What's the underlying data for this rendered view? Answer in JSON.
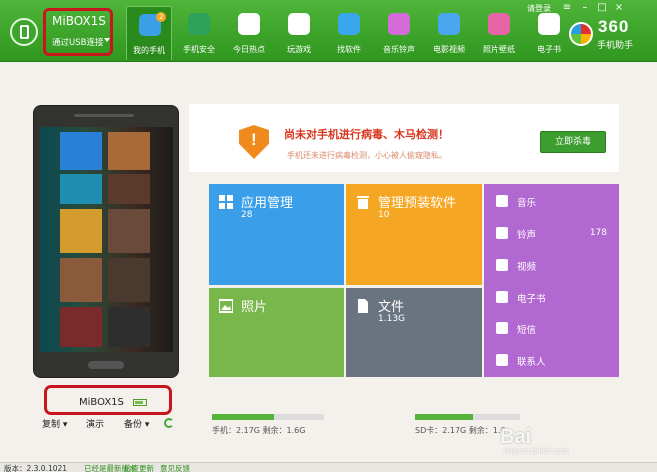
{
  "device": {
    "name": "MiBOX1S",
    "connection": "通过USB连接"
  },
  "nav": {
    "items": [
      {
        "label": "我的手机",
        "active": true,
        "badge": "2",
        "color": "#3aa0e6"
      },
      {
        "label": "手机安全",
        "color": "#2ea15b"
      },
      {
        "label": "今日热点",
        "color": "#ffffff"
      },
      {
        "label": "玩游戏",
        "color": "#ffffff"
      },
      {
        "label": "找软件",
        "color": "#3aa6ec"
      },
      {
        "label": "音乐铃声",
        "color": "#d36cd6"
      },
      {
        "label": "电影视频",
        "color": "#4aa7ef"
      },
      {
        "label": "照片壁纸",
        "color": "#e765a7"
      },
      {
        "label": "电子书",
        "color": "#ffffff"
      }
    ]
  },
  "header": {
    "login": "请登录",
    "logo": "360",
    "logo_sub": "手机助手"
  },
  "alert": {
    "title": "尚未对手机进行病毒、木马检测！",
    "subtitle": "手机还未进行病毒检测，小心被人偷窥隐私。",
    "button": "立即杀毒"
  },
  "tiles": [
    {
      "title": "应用管理",
      "count": "28",
      "color": "#3a9fe8",
      "icon": "grid-icon"
    },
    {
      "title": "管理预装软件",
      "count": "10",
      "color": "#f5a623",
      "icon": "trash-icon"
    },
    {
      "title": "照片",
      "count": "",
      "color": "#78b84a",
      "icon": "photo-icon"
    },
    {
      "title": "文件",
      "count": "1.13G",
      "color": "#6a7480",
      "icon": "file-icon"
    }
  ],
  "side_list": [
    {
      "label": "音乐",
      "count": "",
      "icon": "music-icon"
    },
    {
      "label": "铃声",
      "count": "178",
      "icon": "ringtone-icon"
    },
    {
      "label": "视频",
      "count": "",
      "icon": "video-icon"
    },
    {
      "label": "电子书",
      "count": "",
      "icon": "ebook-icon"
    },
    {
      "label": "短信",
      "count": "",
      "icon": "sms-icon"
    },
    {
      "label": "联系人",
      "count": "",
      "icon": "contacts-icon"
    }
  ],
  "phone": {
    "label": "MiBOX1S",
    "battery_fraction": 0.8,
    "actions": {
      "copy": "复制",
      "demo": "演示",
      "backup": "备份"
    }
  },
  "storage": {
    "phone_text": "手机：2.17G    剩余：1.6G",
    "phone_used_fraction": 0.55,
    "sd_text": "SD卡：2.17G    剩余：1.6",
    "sd_used_fraction": 0.55
  },
  "status": {
    "version": "版本：2.3.0.1021",
    "left_a": "已经是最新版本",
    "left_b": "检查更新",
    "left_c": "意见反馈"
  },
  "watermark": {
    "main": "Bai",
    "sub": "jingyan.baidu.com"
  },
  "colors": {
    "brand_green": "#3aa52a",
    "alert_red": "#d9341d",
    "side_purple": "#b268d1"
  }
}
